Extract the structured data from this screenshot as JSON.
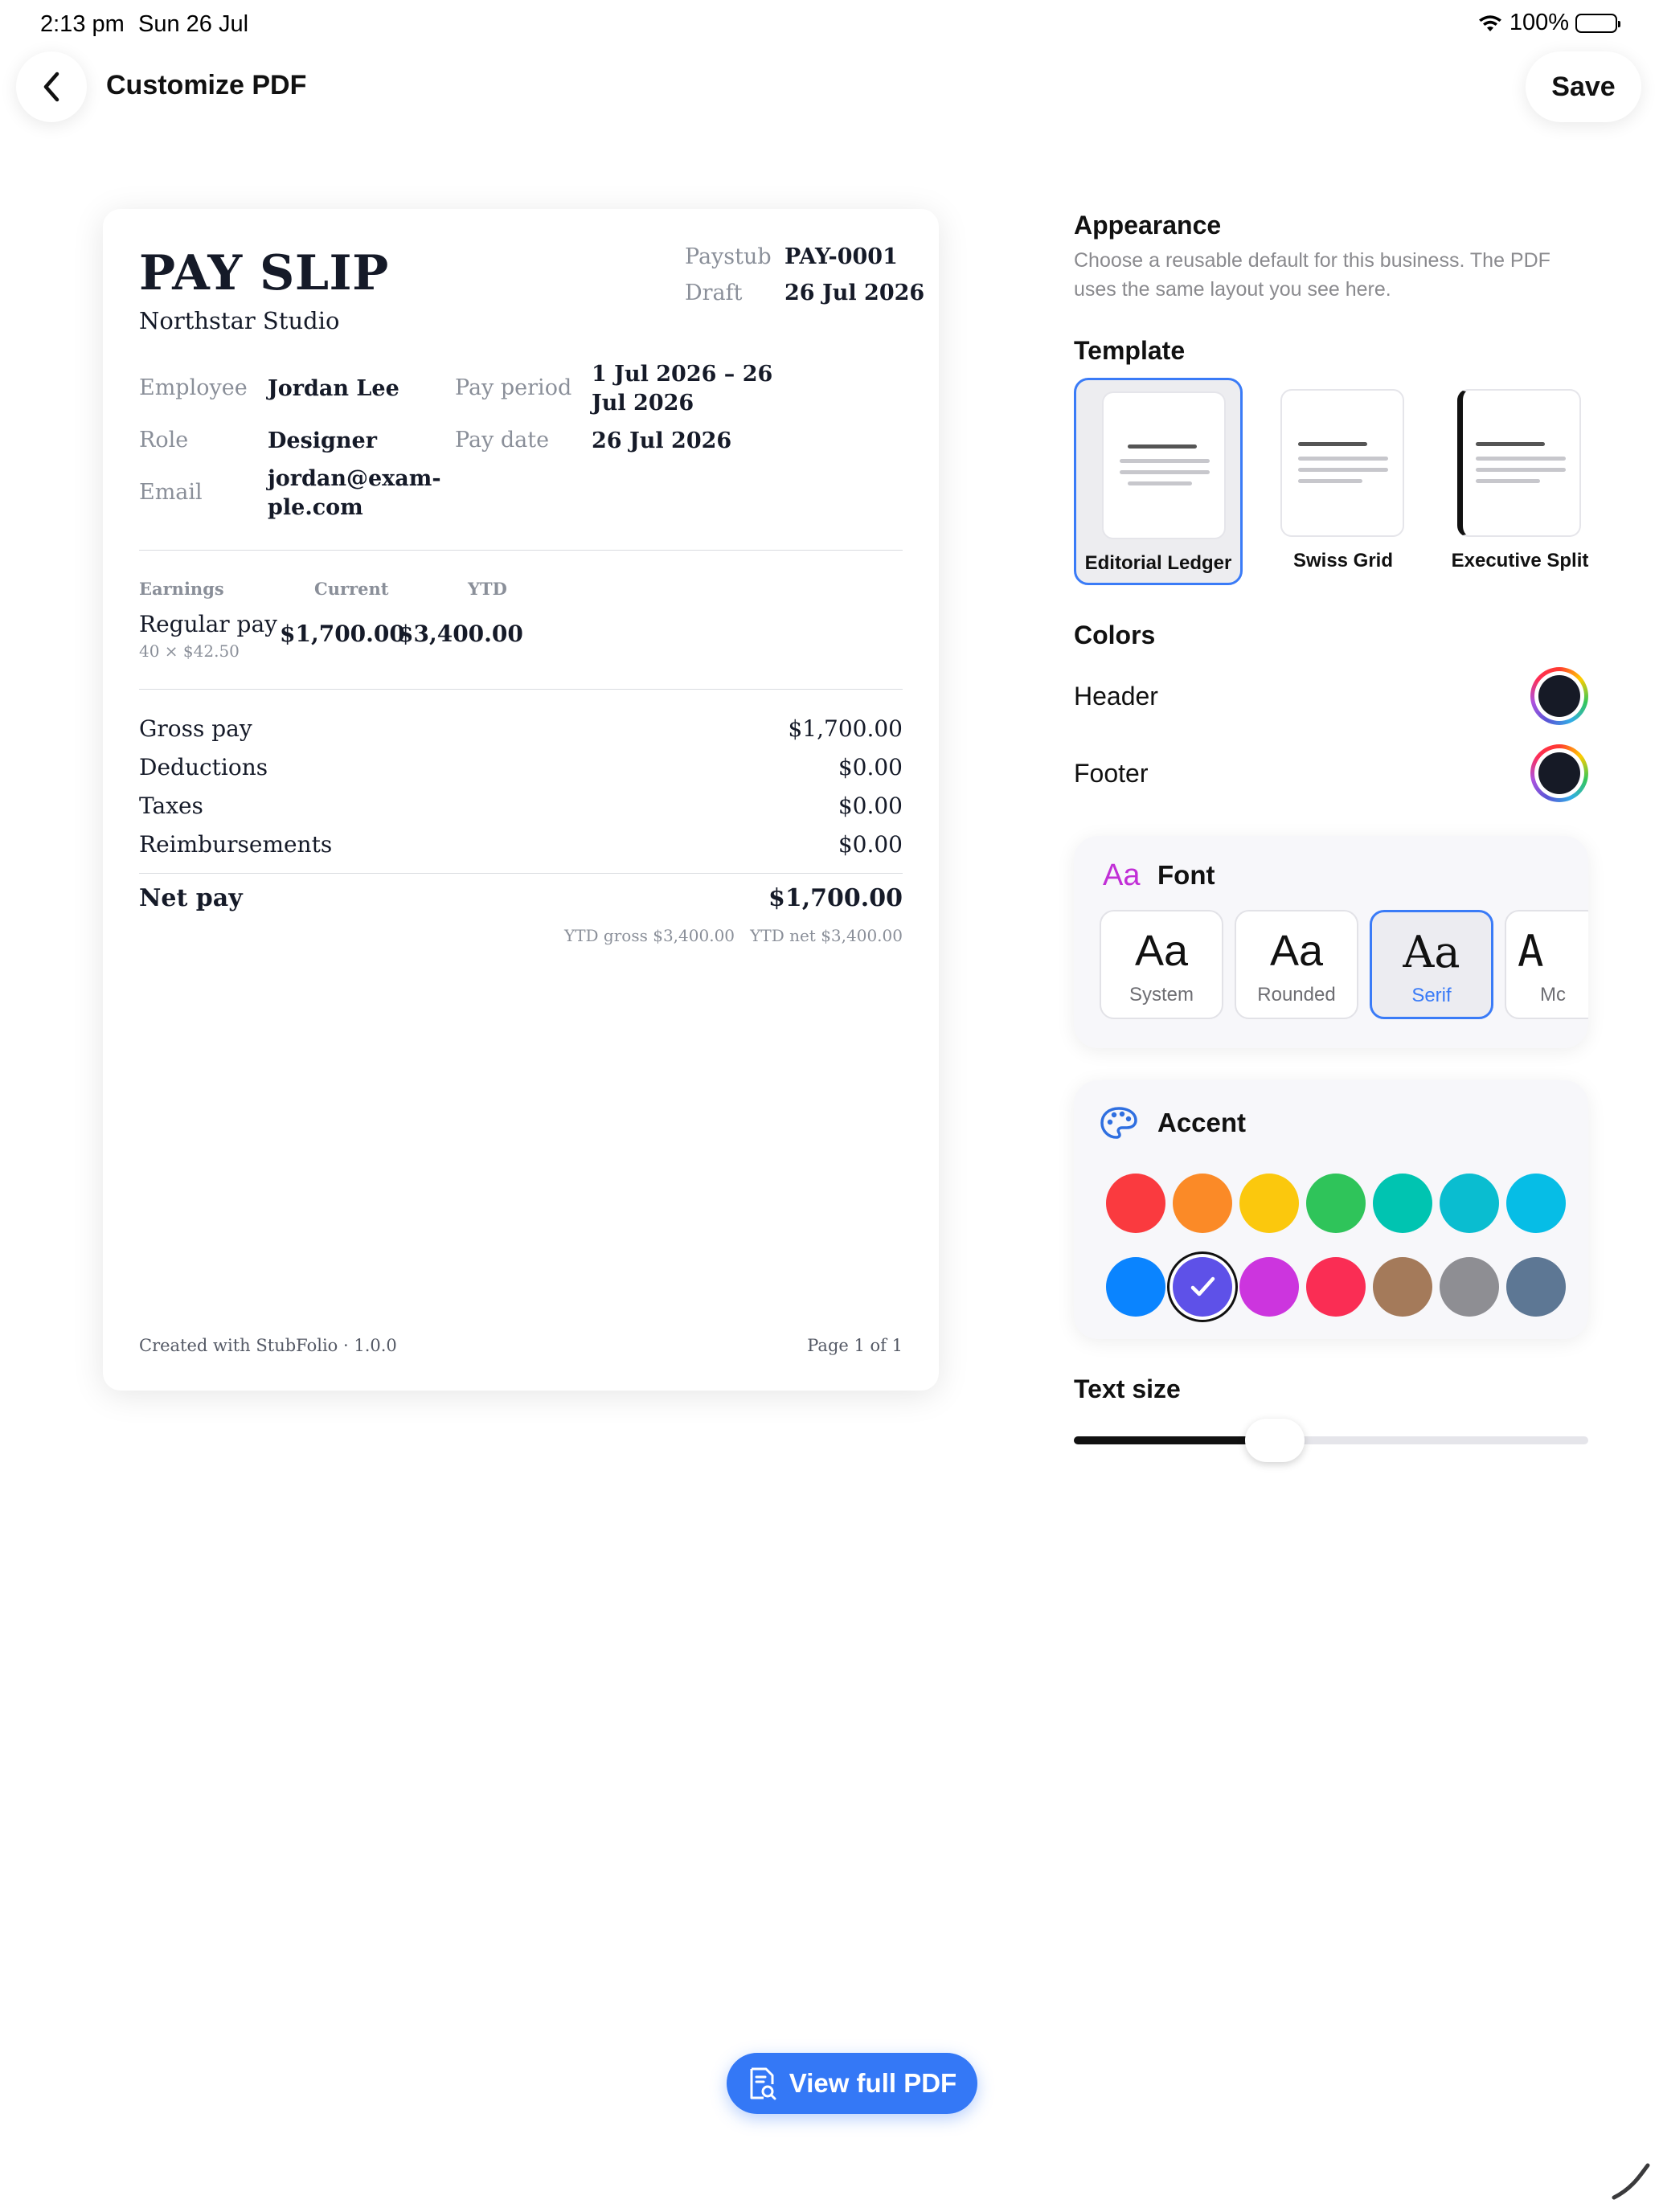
{
  "status_bar": {
    "time": "2:13 pm",
    "date": "Sun 26 Jul",
    "battery": "100%"
  },
  "nav": {
    "title": "Customize PDF",
    "save_label": "Save"
  },
  "pdf": {
    "title": "PAY SLIP",
    "company": "Northstar Studio",
    "meta": [
      {
        "label": "Paystub",
        "value": "PAY-0001"
      },
      {
        "label": "Draft",
        "value": "26 Jul 2026"
      }
    ],
    "employee": {
      "employee_label": "Employee",
      "employee_value": "Jordan Lee",
      "role_label": "Role",
      "role_value": "Designer",
      "email_label": "Email",
      "email_value_1": "jordan@exam-",
      "email_value_2": "ple.com",
      "pay_period_label": "Pay period",
      "pay_period_value_1": "1 Jul 2026 – 26",
      "pay_period_value_2": "Jul 2026",
      "pay_date_label": "Pay date",
      "pay_date_value": "26 Jul 2026"
    },
    "earnings": {
      "headers": [
        "Earnings",
        "Current",
        "YTD"
      ],
      "rows": [
        {
          "label": "Regular pay",
          "detail": "40 × $42.50",
          "current": "$1,700.00",
          "ytd": "$3,400.00"
        }
      ]
    },
    "summary": [
      {
        "label": "Gross pay",
        "value": "$1,700.00"
      },
      {
        "label": "Deductions",
        "value": "$0.00"
      },
      {
        "label": "Taxes",
        "value": "$0.00"
      },
      {
        "label": "Reimbursements",
        "value": "$0.00"
      }
    ],
    "net": {
      "label": "Net pay",
      "value": "$1,700.00",
      "ytd_gross": "YTD gross $3,400.00",
      "ytd_net": "YTD net $3,400.00"
    },
    "footer": {
      "left": "Created with StubFolio · 1.0.0",
      "right": "Page 1 of 1"
    }
  },
  "settings": {
    "appearance": {
      "title": "Appearance",
      "desc_1": "Choose a reusable default for this business. The PDF",
      "desc_2": "uses the same layout you see here."
    },
    "template": {
      "title": "Template",
      "options": [
        {
          "label": "Editorial Ledger",
          "selected": true
        },
        {
          "label": "Swiss Grid",
          "selected": false
        },
        {
          "label": "Executive Split",
          "selected": false
        }
      ]
    },
    "colors": {
      "title": "Colors",
      "header_label": "Header",
      "header_color": "#161a26",
      "footer_label": "Footer",
      "footer_color": "#161a26"
    },
    "font": {
      "icon_text": "Aa",
      "title": "Font",
      "options": [
        {
          "sample": "Aa",
          "name": "System",
          "selected": false
        },
        {
          "sample": "Aa",
          "name": "Rounded",
          "selected": false
        },
        {
          "sample": "Aa",
          "name": "Serif",
          "selected": true
        },
        {
          "sample": "A",
          "name": "Mc",
          "selected": false
        }
      ]
    },
    "accent": {
      "title": "Accent",
      "icon": "palette-icon",
      "swatches": [
        "#fa3a3f",
        "#fb8a27",
        "#fbc80d",
        "#2fc45a",
        "#00c4b1",
        "#0abdd0",
        "#06bde6",
        "#0a84ff",
        "#5e51e8",
        "#cc35de",
        "#fa2d54",
        "#a47a5a",
        "#8e8e93",
        "#5d7794"
      ],
      "selected_index": 8
    },
    "text_size": {
      "title": "Text size",
      "value_fraction": 0.39
    }
  },
  "view_pdf": {
    "label": "View full PDF",
    "icon": "document-search-icon"
  }
}
